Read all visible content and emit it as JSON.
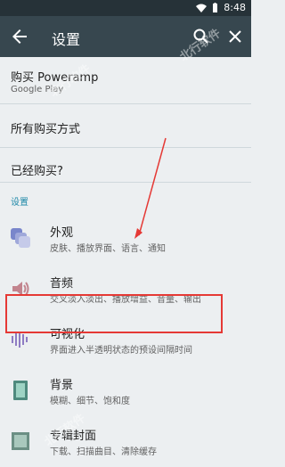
{
  "status": {
    "time": "8:48"
  },
  "appbar": {
    "title": "设置"
  },
  "items": {
    "buy": {
      "title": "购买 Poweramp",
      "subtitle": "Google Play"
    },
    "all_methods": {
      "title": "所有购买方式"
    },
    "already_bought": {
      "title": "已经购买?"
    }
  },
  "section_label": "设置",
  "settings": [
    {
      "label": "外观",
      "desc": "皮肤、播放界面、语言、通知",
      "icon": "appearance-icon"
    },
    {
      "label": "音频",
      "desc": "交叉淡入淡出、播放增益、音量、输出",
      "icon": "audio-icon"
    },
    {
      "label": "可视化",
      "desc": "界面进入半透明状态的预设间隔时间",
      "icon": "visualization-icon"
    },
    {
      "label": "背景",
      "desc": "模糊、细节、饱和度",
      "icon": "background-icon"
    },
    {
      "label": "专辑封面",
      "desc": "下载、扫描曲目、清除缓存",
      "icon": "album-cover-icon"
    }
  ],
  "colors": {
    "appbar": "#37474f",
    "statusbar": "#263238",
    "accent": "#1e88a8",
    "highlight": "#e53935"
  },
  "watermark": "北行软件"
}
